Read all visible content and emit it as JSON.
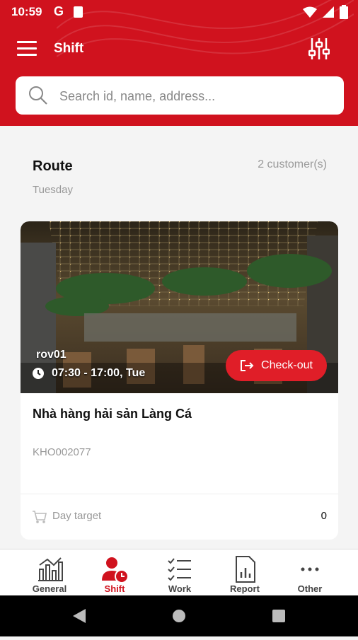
{
  "status_bar": {
    "time": "10:59",
    "g_label": "G"
  },
  "header": {
    "title": "Shift"
  },
  "search": {
    "placeholder": "Search id, name, address..."
  },
  "route": {
    "title": "Route",
    "count": "2 customer(s)",
    "day": "Tuesday"
  },
  "card": {
    "tag": "rov01",
    "time": "07:30 - 17:00, Tue",
    "checkout_label": "Check-out",
    "customer_name": "Nhà hàng hải sản Làng Cá",
    "customer_code": "KHO002077",
    "target_label": "Day target",
    "target_value": "0"
  },
  "bottom_nav": {
    "items": [
      {
        "label": "General",
        "icon": "chart-icon"
      },
      {
        "label": "Shift",
        "icon": "user-clock-icon"
      },
      {
        "label": "Work",
        "icon": "checklist-icon"
      },
      {
        "label": "Report",
        "icon": "report-icon"
      },
      {
        "label": "Other",
        "icon": "more-icon"
      }
    ],
    "active": "Shift"
  },
  "colors": {
    "primary": "#d0121e",
    "accent": "#e01e28"
  }
}
